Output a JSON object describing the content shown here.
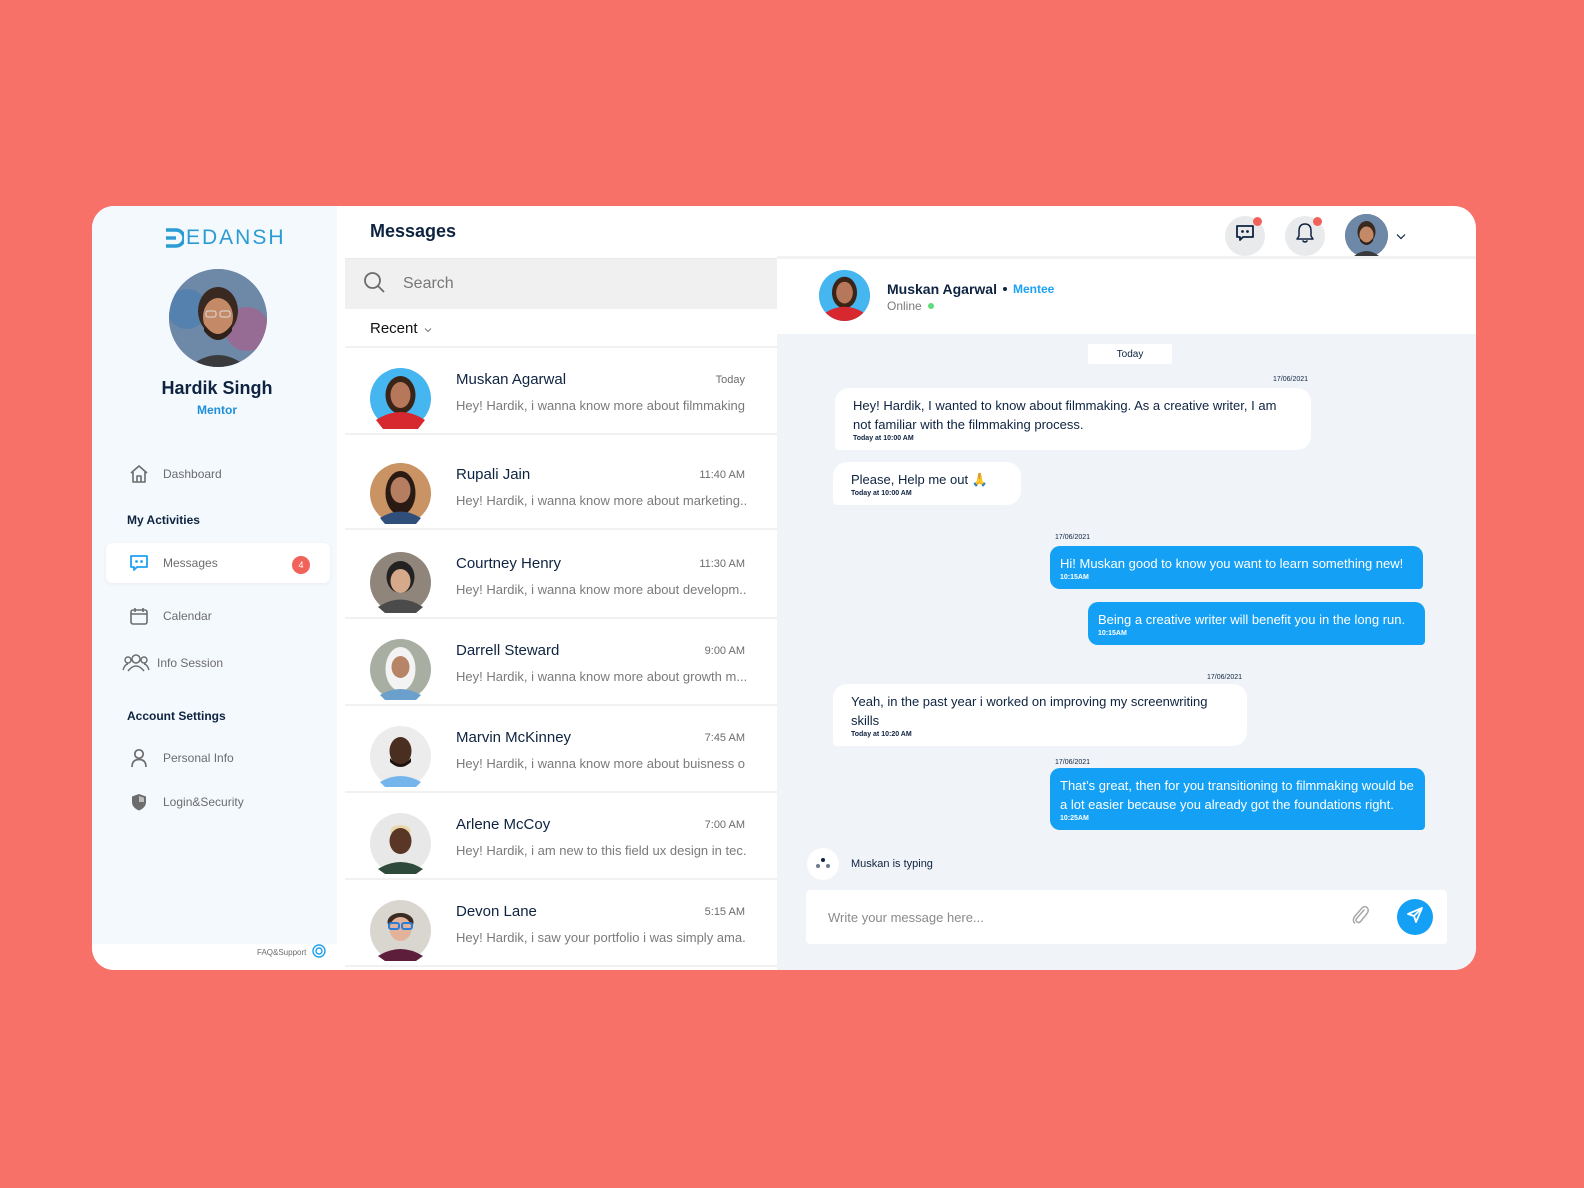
{
  "brand": {
    "name": "EDANSH",
    "color": "#2A9BD3"
  },
  "profile": {
    "name": "Hardik Singh",
    "role": "Mentor"
  },
  "sidebar": {
    "dashboard": {
      "label": "Dashboard",
      "icon": "home-icon"
    },
    "sections": [
      {
        "title": "My Activities"
      },
      {
        "title": "Account Settings"
      }
    ],
    "activities": [
      {
        "label": "Messages",
        "icon": "chat-icon",
        "badge": "4",
        "active": true
      },
      {
        "label": "Calendar",
        "icon": "calendar-icon"
      },
      {
        "label": "Info Session",
        "icon": "users-icon"
      }
    ],
    "settings": [
      {
        "label": "Personal Info",
        "icon": "user-icon"
      },
      {
        "label": "Login&Security",
        "icon": "shield-icon"
      }
    ],
    "faq_label": "FAQ&Support"
  },
  "messages_panel": {
    "title": "Messages",
    "search_placeholder": "Search",
    "filter_label": "Recent",
    "conversations": [
      {
        "name": "Muskan Agarwal",
        "time": "Today",
        "preview": "Hey! Hardik, i wanna know more about filmmaking."
      },
      {
        "name": "Rupali Jain",
        "time": "11:40 AM",
        "preview": "Hey! Hardik, i wanna know more about marketing.."
      },
      {
        "name": "Courtney Henry",
        "time": "11:30 AM",
        "preview": "Hey! Hardik, i wanna know more about developm..."
      },
      {
        "name": "Darrell Steward",
        "time": "9:00 AM",
        "preview": "Hey! Hardik, i wanna know more about growth m..."
      },
      {
        "name": "Marvin McKinney",
        "time": "7:45 AM",
        "preview": "Hey! Hardik, i wanna know more about buisness o..."
      },
      {
        "name": "Arlene McCoy",
        "time": "7:00 AM",
        "preview": "Hey! Hardik, i am new to this field ux design in tec..."
      },
      {
        "name": "Devon Lane",
        "time": "5:15 AM",
        "preview": "Hey! Hardik, i saw your portfolio i was simply ama..."
      }
    ]
  },
  "header": {
    "messages_icon": "chat-icon",
    "notifications_icon": "bell-icon",
    "has_unread_messages": true,
    "has_unread_notifications": true
  },
  "chat": {
    "contact_name": "Muskan Agarwal",
    "contact_role": "Mentee",
    "status": "Online",
    "day_label": "Today",
    "typing_text": "Muskan is typing",
    "composer_placeholder": "Write your message here...",
    "messages": [
      {
        "direction": "in",
        "date": "17/06/2021",
        "text": "Hey! Hardik, I wanted to know about filmmaking. As a creative writer, I am not familiar with the filmmaking process.",
        "time": "Today at 10:00 AM"
      },
      {
        "direction": "in",
        "date": "",
        "text": "Please, Help me out  🙏",
        "time": "Today at 10:00 AM"
      },
      {
        "direction": "out",
        "date": "17/06/2021",
        "text": "Hi! Muskan good to know you want to learn something new!",
        "time": "10:15AM"
      },
      {
        "direction": "out",
        "date": "",
        "text": "Being a creative writer will benefit you in the long run.",
        "time": "10:15AM"
      },
      {
        "direction": "in",
        "date": "17/06/2021",
        "text": "Yeah, in the past year i worked on improving my screenwriting skills",
        "time": "Today at 10:20 AM"
      },
      {
        "direction": "out",
        "date": "17/06/2021",
        "text": "That’s great, then for you transitioning to filmmaking would be a lot easier because you already got the foundations right.",
        "time": "10:25AM"
      }
    ]
  },
  "colors": {
    "background": "#F87168",
    "accent": "#14A0F4",
    "badge": "#F0625A",
    "online": "#5FDB7A",
    "heading": "#0E2340"
  }
}
